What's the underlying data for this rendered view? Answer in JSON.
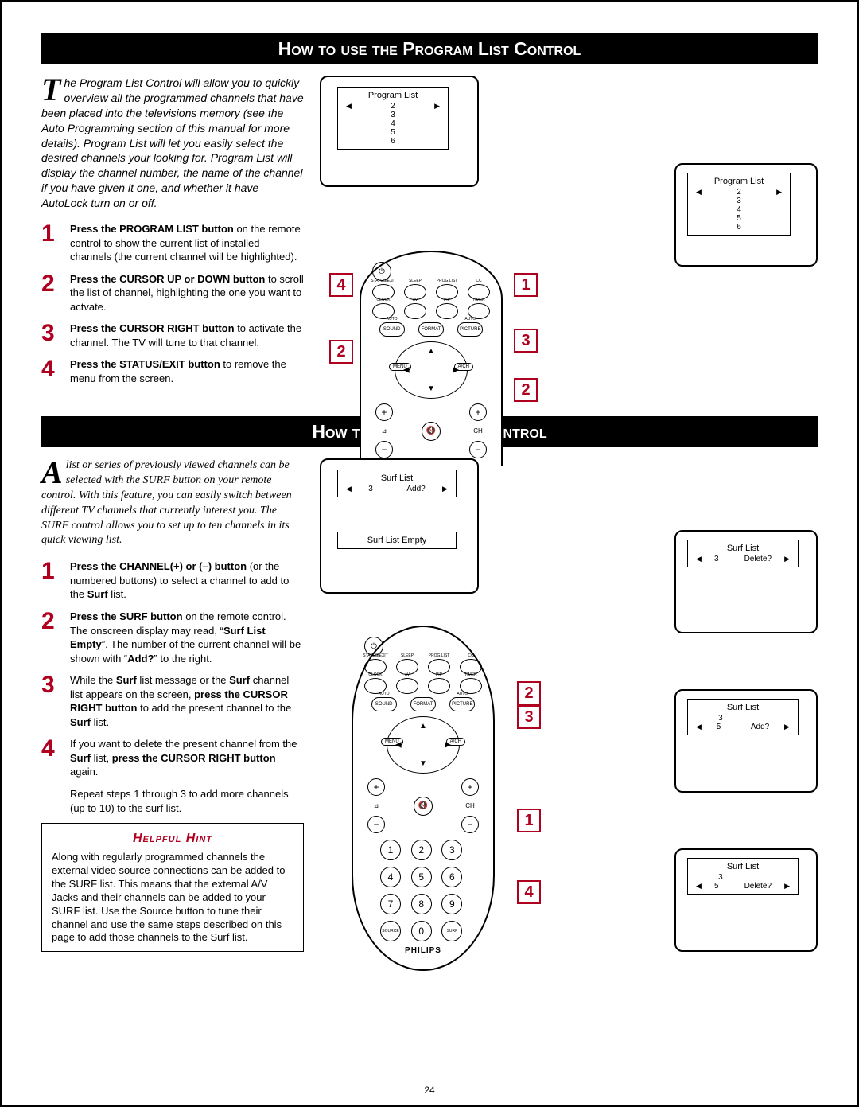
{
  "page_number": "24",
  "section1": {
    "title": "How to use the Program List Control",
    "intro": "he Program List Control will allow you to quickly overview all the programmed channels that have been placed into the televisions memory (see the Auto Programming section of this manual for more details). Program List will let you easily select the desired channels your looking for. Program List will display the channel number, the name of the channel if you have given it one, and whether it have AutoLock turn on or off.",
    "dropcap": "T",
    "steps": [
      {
        "n": "1",
        "html": "<b>Press the PROGRAM LIST button</b> on the remote control to show the current list of installed channels (the current channel will be highlighted)."
      },
      {
        "n": "2",
        "html": "<b>Press the CURSOR UP or DOWN button</b> to  scroll the list of channel, highlighting the one you want to actvate."
      },
      {
        "n": "3",
        "html": "<b>Press the CURSOR RIGHT button</b> to activate the channel. The TV will tune to that channel."
      },
      {
        "n": "4",
        "html": "<b>Press the STATUS/EXIT button</b> to remove the menu from the screen."
      }
    ],
    "osd_title": "Program List",
    "osd_items": [
      "2",
      "3",
      "4",
      "5",
      "6"
    ],
    "callouts": [
      "1",
      "2",
      "3",
      "4"
    ]
  },
  "section2": {
    "title": "How to use the Surf Control",
    "intro": "list or series of previously viewed channels can be selected with the SURF button on your remote control. With this feature, you can easily switch between different TV channels that currently interest you. The SURF control allows you to set up to ten channels in its quick viewing list.",
    "dropcap": "A",
    "steps": [
      {
        "n": "1",
        "html": "<b>Press the CHANNEL(+) or (–) button</b> (or the numbered buttons) to select a channel to add to the <b>Surf</b> list."
      },
      {
        "n": "2",
        "html": "<b>Press the SURF button</b> on the remote control. The onscreen display may read, “<b>Surf List Empty</b>”. The number of the current channel will be shown with “<b>Add?</b>” to the right."
      },
      {
        "n": "3",
        "html": "While the <b>Surf</b> list message or the <b>Surf</b> channel list appears on the screen, <b>press the CURSOR RIGHT button</b> to add the present channel to the <b>Surf</b> list."
      },
      {
        "n": "4",
        "html": "If you want to delete the present channel from the <b>Surf</b> list, <b>press the CURSOR RIGHT button</b> again."
      }
    ],
    "repeat": "Repeat steps 1 through 3 to add more channels (up to 10) to the surf list.",
    "hint_title": "Helpful  Hint",
    "hint_body": "Along with regularly programmed channels the external video source connections can be added to the SURF list.  This means that the external A/V Jacks and their channels can be added to your SURF list.  Use the Source button to tune their channel and use the same steps described on this page to add those channels to the Surf list.",
    "osd": {
      "title": "Surf List",
      "add_row": {
        "num": "3",
        "action": "Add?"
      },
      "empty": "Surf List Empty",
      "delete_row": {
        "num": "3",
        "action": "Delete?"
      },
      "add2": {
        "nums": [
          "3",
          "5"
        ],
        "action": "Add?"
      },
      "del2": {
        "nums": [
          "3",
          "5"
        ],
        "action": "Delete?"
      }
    },
    "callouts": [
      "1",
      "2",
      "3",
      "4"
    ]
  },
  "remote": {
    "power": "⏻",
    "row1": [
      "STATUS/EXIT",
      "SLEEP",
      "PROG.LIST",
      "CC"
    ],
    "row2": [
      "CLOCK",
      "AV",
      "PIP",
      "TIMER"
    ],
    "row3_pills": [
      "SOUND",
      "FORMAT",
      "PICTURE"
    ],
    "row3_pill_labels": [
      "AUTO",
      "",
      "AUTO"
    ],
    "menu": "MENU",
    "avch": "A/CH",
    "vol": "⊿",
    "ch": "CH",
    "mute": "🔇",
    "numbers": [
      "1",
      "2",
      "3",
      "4",
      "5",
      "6",
      "7",
      "8",
      "9",
      "SOURCE",
      "0",
      "SURF"
    ],
    "brand": "PHILIPS"
  }
}
